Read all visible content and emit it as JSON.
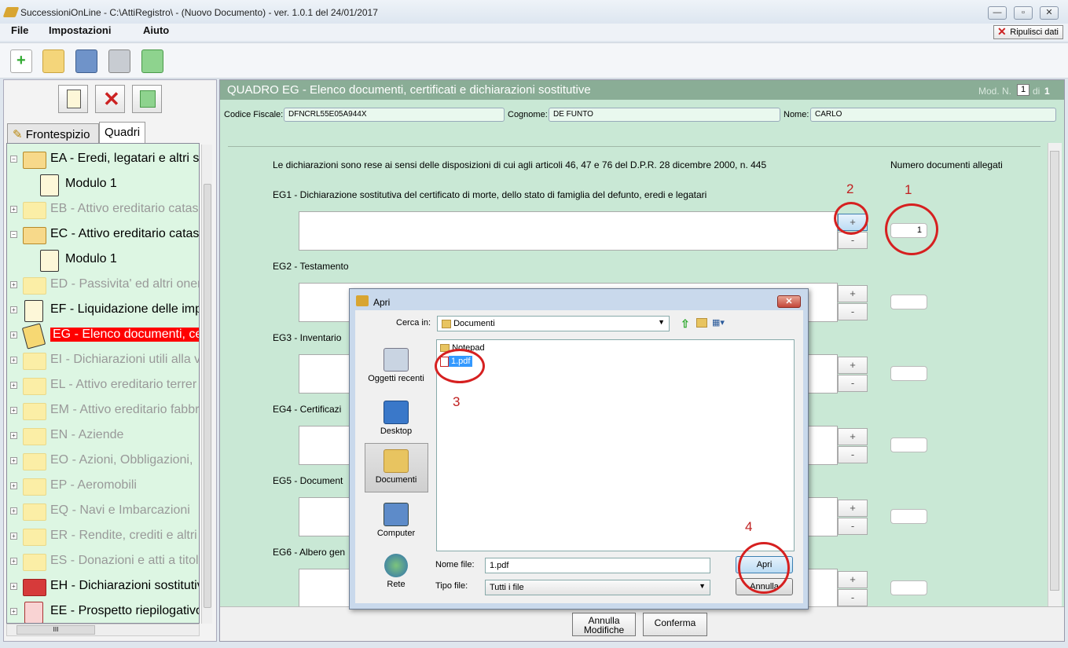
{
  "window": {
    "title": "SuccessioniOnLine - C:\\AttiRegistro\\ - (Nuovo Documento)  -  ver. 1.0.1 del 24/01/2017",
    "minimize": "—",
    "maximize": "▫",
    "close": "✕"
  },
  "menu": {
    "file": "File",
    "impostazioni": "Impostazioni",
    "aiuto": "Aiuto",
    "ripulisci": "Ripulisci dati"
  },
  "left": {
    "tabs": [
      "Frontespizio",
      "Quadri"
    ],
    "tree": [
      {
        "code": "EA - Eredi, legatari e altri s",
        "state": "open"
      },
      {
        "code": "Modulo 1",
        "state": "child"
      },
      {
        "code": "EB - Attivo ereditario catas",
        "state": "grey"
      },
      {
        "code": "EC - Attivo ereditario catas",
        "state": "open"
      },
      {
        "code": "Modulo 1",
        "state": "child"
      },
      {
        "code": "ED - Passivita' ed altri oner",
        "state": "grey"
      },
      {
        "code": "EF - Liquidazione delle imp",
        "state": "doc"
      },
      {
        "code": "EG - Elenco documenti, cer",
        "state": "selected"
      },
      {
        "code": "EI - Dichiarazioni utili alla v",
        "state": "grey"
      },
      {
        "code": "EL - Attivo ereditario terrer",
        "state": "grey"
      },
      {
        "code": "EM - Attivo ereditario fabbr",
        "state": "grey"
      },
      {
        "code": "EN - Aziende",
        "state": "grey"
      },
      {
        "code": "EO - Azioni, Obbligazioni, ",
        "state": "grey"
      },
      {
        "code": "EP - Aeromobili",
        "state": "grey"
      },
      {
        "code": "EQ - Navi e Imbarcazioni",
        "state": "grey"
      },
      {
        "code": "ER - Rendite, crediti e altri",
        "state": "grey"
      },
      {
        "code": "ES - Donazioni e atti a titol",
        "state": "grey"
      },
      {
        "code": "EH - Dichiarazioni sostitutiv",
        "state": "red"
      },
      {
        "code": "EE - Prospetto riepilogativo",
        "state": "reddoc"
      }
    ],
    "hscroll": "III"
  },
  "main": {
    "title": "QUADRO EG - Elenco documenti, certificati e dichiarazioni sostitutive",
    "mod_label": "Mod. N.",
    "mod_num": "1",
    "mod_di": "di",
    "mod_total": "1",
    "codice_fiscale_label": "Codice Fiscale:",
    "codice_fiscale": "DFNCRL55E05A944X",
    "cognome_label": "Cognome:",
    "cognome": "DE FUNTO",
    "nome_label": "Nome:",
    "nome": "CARLO",
    "intro": "Le dichiarazioni sono rese ai sensi delle disposizioni di cui agli articoli 46, 47 e 76 del D.P.R. 28 dicembre 2000, n. 445",
    "numero_label": "Numero documenti allegati",
    "sections": [
      {
        "label": "EG1 - Dichiarazione sostitutiva del certificato di morte, dello stato di famiglia del defunto, eredi e legatari",
        "count": "1"
      },
      {
        "label": "EG2 - Testamento",
        "count": ""
      },
      {
        "label": "EG3 - Inventario",
        "count": ""
      },
      {
        "label": "EG4 - Certificazi",
        "count": ""
      },
      {
        "label": "EG5 - Document",
        "count": ""
      },
      {
        "label": "EG6 - Albero gen",
        "count": ""
      }
    ],
    "plus": "+",
    "minus": "-",
    "annulla": "Annulla Modifiche",
    "conferma": "Conferma"
  },
  "annotations": [
    "1",
    "2",
    "3",
    "4"
  ],
  "dialog": {
    "title": "Apri",
    "cerca_label": "Cerca in:",
    "cerca_value": "Documenti",
    "places": [
      "Oggetti recenti",
      "Desktop",
      "Documenti",
      "Computer",
      "Rete"
    ],
    "files": [
      "Notepad",
      "1.pdf"
    ],
    "nome_file_label": "Nome file:",
    "nome_file": "1.pdf",
    "tipo_file_label": "Tipo file:",
    "tipo_file": "Tutti i file",
    "apri": "Apri",
    "annulla": "Annulla"
  }
}
